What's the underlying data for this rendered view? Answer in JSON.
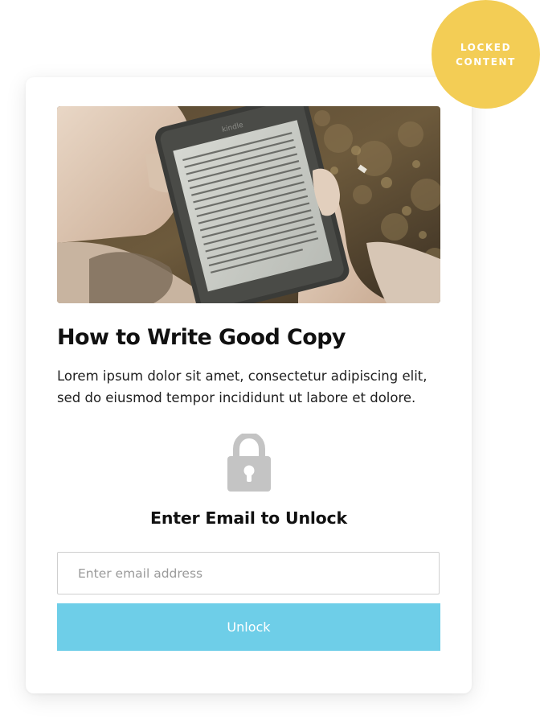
{
  "badge": {
    "line1": "LOCKED",
    "line2": "CONTENT"
  },
  "card": {
    "title": "How to Write Good Copy",
    "description": "Lorem ipsum dolor sit amet, consectetur adipiscing elit, sed do eiusmod tempor incididunt ut labore et dolore.",
    "lock_icon": "lock-icon",
    "unlock_heading": "Enter Email to Unlock",
    "email_placeholder": "Enter email address",
    "email_value": "",
    "button_label": "Unlock"
  },
  "hero_image": {
    "device_brand": "kindle"
  },
  "colors": {
    "badge": "#f3cd55",
    "button": "#6ecee8",
    "lock": "#c4c4c4",
    "title": "#111111"
  }
}
